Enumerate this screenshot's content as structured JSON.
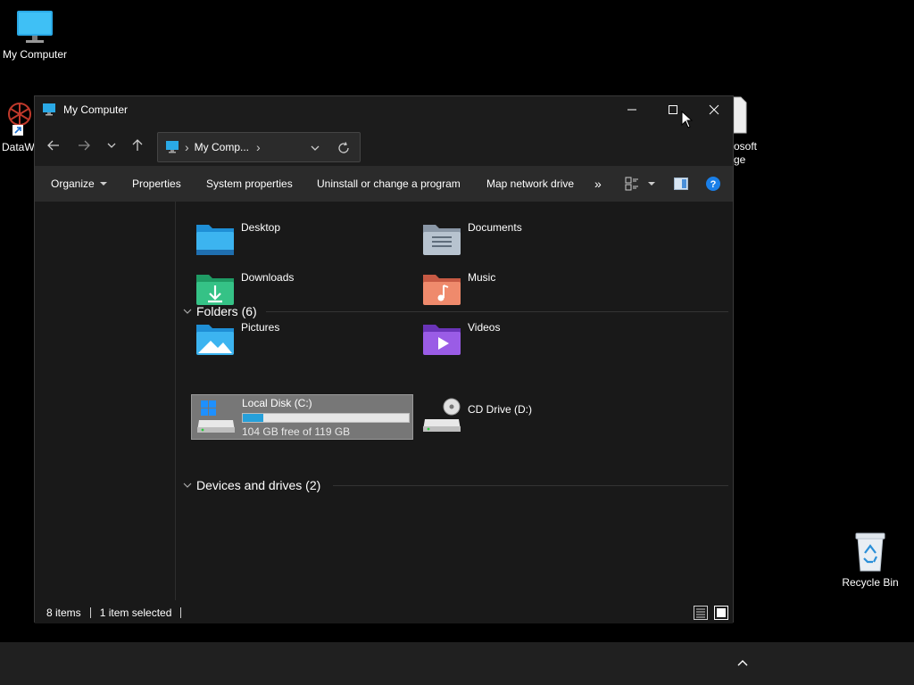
{
  "desktop": {
    "icons": [
      {
        "label": "My Computer",
        "icon": "monitor-icon"
      },
      {
        "label": "DataW",
        "icon": "shortcut-icon"
      },
      {
        "label": "osoft",
        "label2": "ge",
        "icon": "document-icon"
      },
      {
        "label": "Recycle Bin",
        "icon": "recycle-bin-icon"
      }
    ]
  },
  "window": {
    "title": "My Computer",
    "address": {
      "crumb": "My Comp...",
      "sep": "›"
    },
    "commands": {
      "organize": "Organize",
      "properties": "Properties",
      "system_properties": "System properties",
      "uninstall": "Uninstall or change a program",
      "map_drive": "Map network drive",
      "more": "»"
    },
    "groups": {
      "folders": "Folders (6)",
      "devices": "Devices and drives (2)"
    },
    "folders": [
      {
        "name": "Desktop"
      },
      {
        "name": "Documents"
      },
      {
        "name": "Downloads"
      },
      {
        "name": "Music"
      },
      {
        "name": "Pictures"
      },
      {
        "name": "Videos"
      }
    ],
    "drives": [
      {
        "name": "Local Disk (C:)",
        "free_text": "104 GB free of 119 GB",
        "used_fraction": 0.126
      },
      {
        "name": "CD Drive (D:)"
      }
    ],
    "status": {
      "items": "8 items",
      "selected": "1 item selected"
    }
  },
  "colors": {
    "accent": "#26a0da",
    "folder_blue": "#2ea8e8",
    "folder_green": "#2fb57a",
    "folder_orange": "#e8765a",
    "folder_purple": "#8b4fd6",
    "help": "#1a7fe8"
  }
}
